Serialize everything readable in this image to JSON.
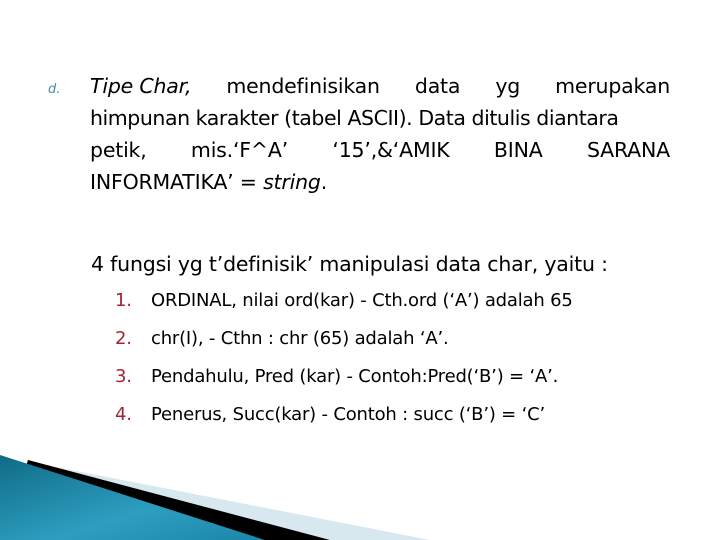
{
  "slide": {
    "bullet": "d.",
    "paragraph": {
      "line1": {
        "words": [
          "Tipe Char,",
          "mendefinisikan",
          "data",
          "yg",
          "merupakan"
        ]
      },
      "line2": "himpunan karakter (tabel ASCII). Data ditulis diantara",
      "line3": {
        "words": [
          "petik,",
          "mis.‘F^A’",
          "‘15’,&‘AMIK",
          "BINA",
          "SARANA"
        ]
      },
      "line4_pre": "INFORMATIKA’ = ",
      "line4_italic": "string",
      "line4_post": "."
    },
    "intro": "4 fungsi yg t’definisik’ manipulasi data char, yaitu :",
    "list": [
      {
        "num": "1.",
        "text": "ORDINAL, nilai ord(kar) - Cth.ord (‘A’) adalah 65"
      },
      {
        "num": "2.",
        "text": "chr(I), - Cthn : chr (65) adalah ‘A’."
      },
      {
        "num": "3.",
        "text": "Pendahulu, Pred (kar) - Contoh:Pred(‘B’) = ‘A’."
      },
      {
        "num": "4.",
        "text": "Penerus, Succ(kar) - Contoh : succ (‘B’) = ‘C’"
      }
    ],
    "colors": {
      "accent_teal": "#1b7f9c",
      "number_red": "#a32436",
      "bullet_teal": "#4a8ba0"
    }
  }
}
